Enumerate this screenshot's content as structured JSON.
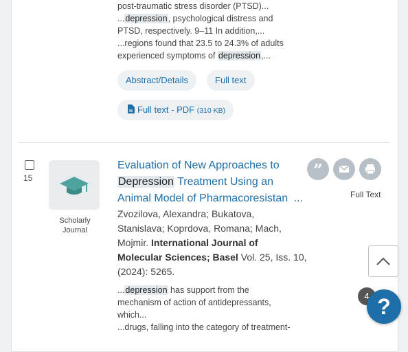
{
  "prev_result": {
    "snippet_1": "post-traumatic stress disorder (PTSD)...",
    "snippet_2_prefix": "...",
    "snippet_2_highlight": "depression",
    "snippet_2_suffix": ", psychological distress and",
    "snippet_3": "PTSD, respectively. 9–11 In addition,...",
    "snippet_4": "...regions found that 23.5 to 24.3% of adults",
    "snippet_5_prefix": "experienced symptoms of ",
    "snippet_5_highlight": "depression",
    "snippet_5_suffix": ",...",
    "abstract_label": "Abstract/Details",
    "fulltext_label": "Full text",
    "pdf_label": "Full text - PDF",
    "pdf_size": "(310 KB)"
  },
  "result": {
    "index": "15",
    "source_type_line1": "Scholarly",
    "source_type_line2": "Journal",
    "title_line1": "Evaluation of New Approaches to",
    "title_highlight": "Depression",
    "title_line2_suffix": " Treatment Using an",
    "title_line3": "Animal Model of Pharmacoresistan",
    "title_ellipsis": "...",
    "authors_line1": "Zvozilova, Alexandra; Bukatova,",
    "authors_line2": "Stanislava; Koprdova, Romana; Mach,",
    "authors_line3": "Mojmir.",
    "journal_line1": "International Journal of",
    "journal_line2": "Molecular Sciences; Basel",
    "volume_line1": " Vol. 25, Iss. 10,",
    "volume_line2": "(2024): 5265.",
    "snip_1_prefix": "...",
    "snip_1_highlight": "depression",
    "snip_1_suffix": " has support from the",
    "snip_2": "mechanism of action of antidepressants,",
    "snip_3": "which...",
    "snip_4": "...drugs, falling into the category of treatment-",
    "fulltext_label": "Full Text"
  },
  "widgets": {
    "badge_count": "4",
    "help_glyph": "?"
  },
  "colors": {
    "link": "#1e6ea7",
    "highlight": "#e3e8ec",
    "help": "#1e6ea7",
    "teal": "#4fa39e"
  }
}
